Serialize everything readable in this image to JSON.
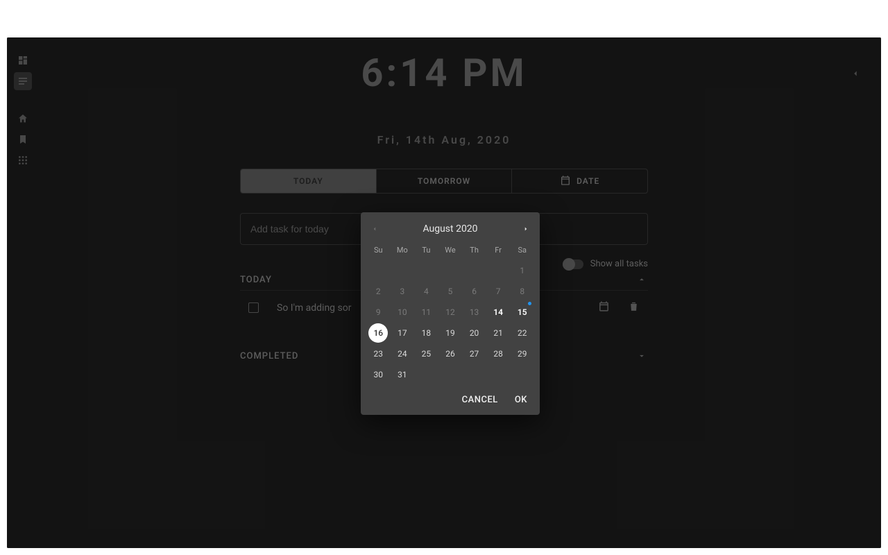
{
  "clock": "6:14 PM",
  "date": "Fri, 14th Aug, 2020",
  "tabs": {
    "today": "TODAY",
    "tomorrow": "TOMORROW",
    "date": "DATE"
  },
  "input": {
    "placeholder": "Add task for today"
  },
  "toggle_label": "Show all tasks",
  "sections": {
    "today": "TODAY",
    "completed": "COMPLETED"
  },
  "task1": "So I'm adding sor",
  "picker": {
    "title": "August 2020",
    "dow": {
      "su": "Su",
      "mo": "Mo",
      "tu": "Tu",
      "we": "We",
      "th": "Th",
      "fr": "Fr",
      "sa": "Sa"
    },
    "days": {
      "d1": "1",
      "d2": "2",
      "d3": "3",
      "d4": "4",
      "d5": "5",
      "d6": "6",
      "d7": "7",
      "d8": "8",
      "d9": "9",
      "d10": "10",
      "d11": "11",
      "d12": "12",
      "d13": "13",
      "d14": "14",
      "d15": "15",
      "d16": "16",
      "d17": "17",
      "d18": "18",
      "d19": "19",
      "d20": "20",
      "d21": "21",
      "d22": "22",
      "d23": "23",
      "d24": "24",
      "d25": "25",
      "d26": "26",
      "d27": "27",
      "d28": "28",
      "d29": "29",
      "d30": "30",
      "d31": "31"
    },
    "cancel": "CANCEL",
    "ok": "OK",
    "selected_day": 16,
    "today_day": 14,
    "dot_day": 15
  }
}
